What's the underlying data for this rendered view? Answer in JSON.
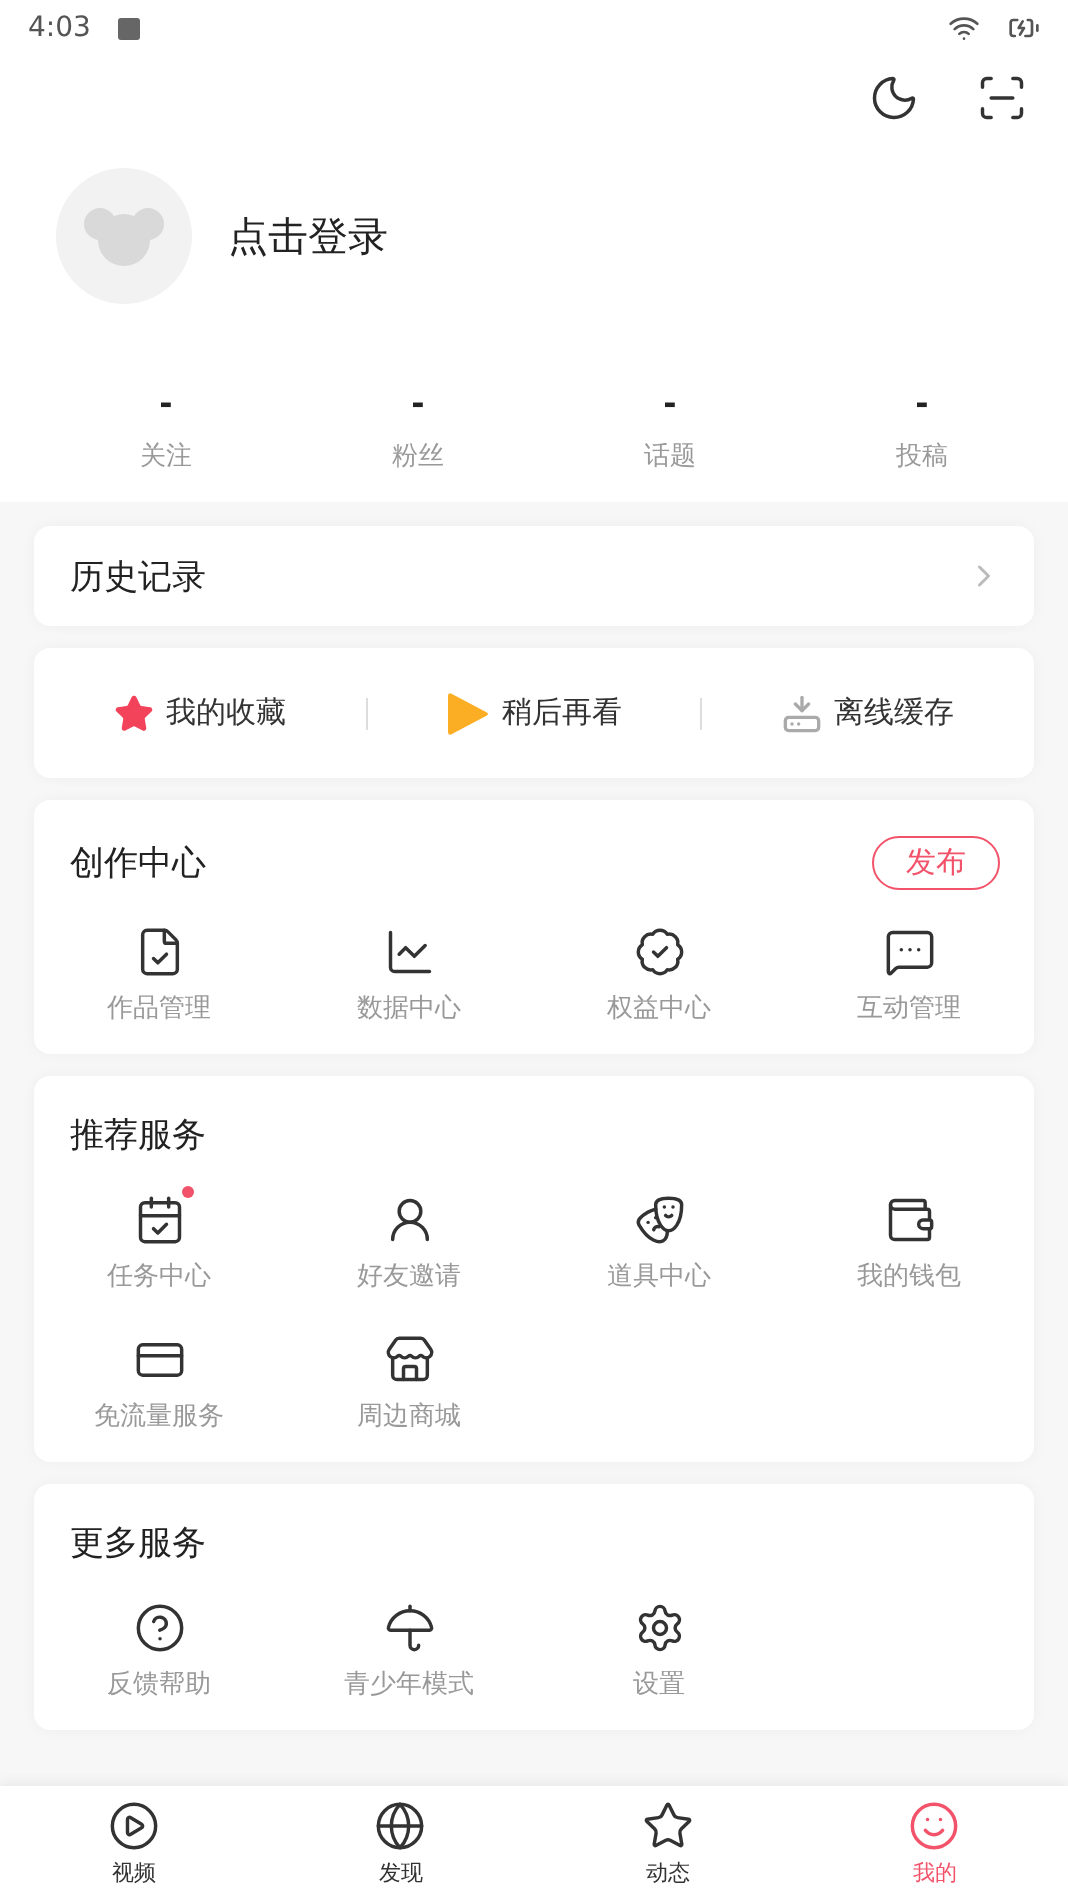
{
  "status_bar": {
    "time": "4:03"
  },
  "profile": {
    "login_text": "点击登录"
  },
  "stats": [
    {
      "value": "-",
      "label": "关注"
    },
    {
      "value": "-",
      "label": "粉丝"
    },
    {
      "value": "-",
      "label": "话题"
    },
    {
      "value": "-",
      "label": "投稿"
    }
  ],
  "history": {
    "title": "历史记录"
  },
  "quick_actions": [
    {
      "kind": "favorites",
      "label": "我的收藏"
    },
    {
      "kind": "watch_later",
      "label": "稍后再看"
    },
    {
      "kind": "offline",
      "label": "离线缓存"
    }
  ],
  "creation_center": {
    "title": "创作中心",
    "publish_button": "发布",
    "items": [
      {
        "kind": "works",
        "label": "作品管理"
      },
      {
        "kind": "data",
        "label": "数据中心"
      },
      {
        "kind": "rights",
        "label": "权益中心"
      },
      {
        "kind": "interaction",
        "label": "互动管理"
      }
    ]
  },
  "recommended_services": {
    "title": "推荐服务",
    "items": [
      {
        "kind": "tasks",
        "label": "任务中心",
        "dot": true
      },
      {
        "kind": "invite",
        "label": "好友邀请",
        "dot": false
      },
      {
        "kind": "props",
        "label": "道具中心",
        "dot": false
      },
      {
        "kind": "wallet",
        "label": "我的钱包",
        "dot": false
      },
      {
        "kind": "free_data",
        "label": "免流量服务",
        "dot": false
      },
      {
        "kind": "mall",
        "label": "周边商城",
        "dot": false
      }
    ]
  },
  "more_services": {
    "title": "更多服务",
    "items": [
      {
        "kind": "feedback",
        "label": "反馈帮助"
      },
      {
        "kind": "teen",
        "label": "青少年模式"
      },
      {
        "kind": "settings",
        "label": "设置"
      }
    ]
  },
  "tab_bar": [
    {
      "kind": "video",
      "label": "视频",
      "selected": false
    },
    {
      "kind": "discover",
      "label": "发现",
      "selected": false
    },
    {
      "kind": "feed",
      "label": "动态",
      "selected": false
    },
    {
      "kind": "mine",
      "label": "我的",
      "selected": true
    }
  ]
}
